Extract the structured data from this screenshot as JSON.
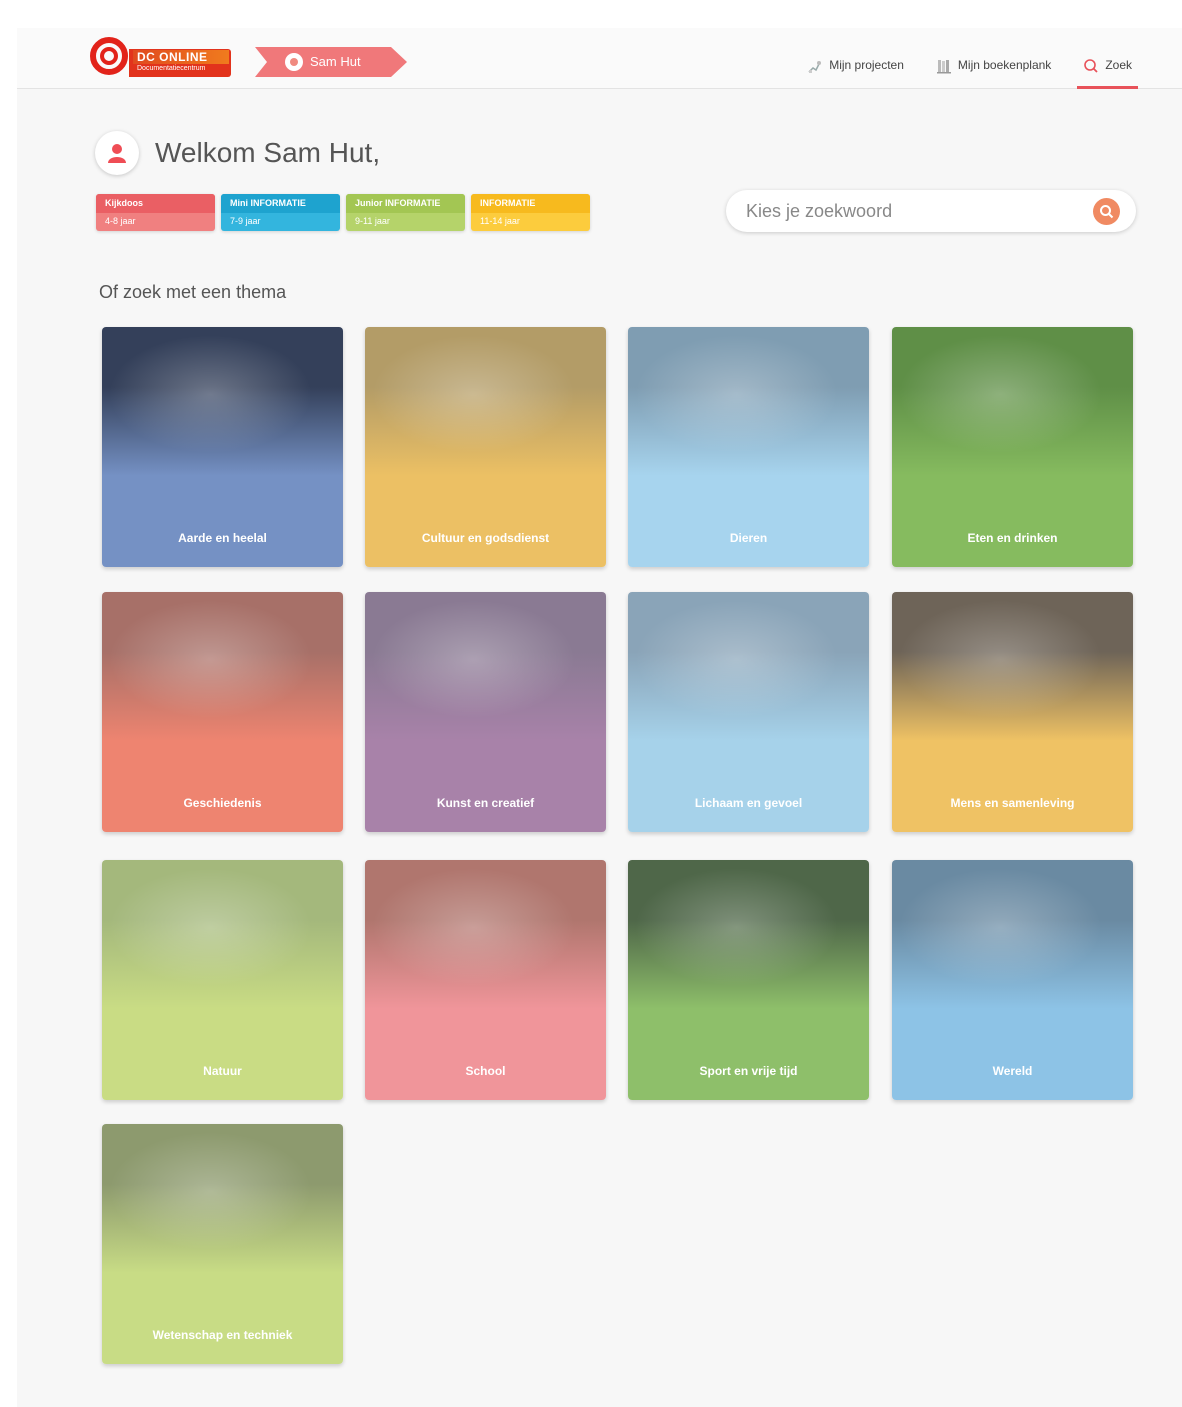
{
  "header": {
    "logo_title": "DC ONLINE",
    "logo_subtitle": "Documentatiecentrum",
    "user_tab": "Sam Hut",
    "nav": [
      {
        "label": "Mijn projecten",
        "icon": "projects-icon"
      },
      {
        "label": "Mijn boekenplank",
        "icon": "bookshelf-icon"
      },
      {
        "label": "Zoek",
        "icon": "search-icon",
        "active": true
      }
    ]
  },
  "welcome": "Welkom Sam Hut,",
  "age_groups": [
    {
      "name": "Kijkdoos",
      "range": "4-8 jaar",
      "color": "#f08080",
      "color_dark": "#ea5f64"
    },
    {
      "name": "Mini INFORMATIE",
      "range": "7-9 jaar",
      "color": "#33b5de",
      "color_dark": "#1ea3cf"
    },
    {
      "name": "Junior INFORMATIE",
      "range": "9-11 jaar",
      "color": "#b5d36a",
      "color_dark": "#a3c653"
    },
    {
      "name": "INFORMATIE",
      "range": "11-14 jaar",
      "color": "#fccc3d",
      "color_dark": "#f7ba1e"
    }
  ],
  "search": {
    "placeholder": "Kies je zoekwoord"
  },
  "theme_heading": "Of zoek met een thema",
  "themes": [
    {
      "label": "Aarde en heelal",
      "color": "#7591c4",
      "dark": "#34405a"
    },
    {
      "label": "Cultuur en godsdienst",
      "color": "#ecc064",
      "dark": "#b39c67"
    },
    {
      "label": "Dieren",
      "color": "#a7d4ee",
      "dark": "#7f9db2"
    },
    {
      "label": "Eten en drinken",
      "color": "#86bb5f",
      "dark": "#5f8f47"
    },
    {
      "label": "Geschiedenis",
      "color": "#ee8470",
      "dark": "#a77068"
    },
    {
      "label": "Kunst en creatief",
      "color": "#a882a9",
      "dark": "#8a7a93"
    },
    {
      "label": "Lichaam en gevoel",
      "color": "#a6d2ea",
      "dark": "#8aa4b8"
    },
    {
      "label": "Mens en samenleving",
      "color": "#efc264",
      "dark": "#6e6458"
    },
    {
      "label": "Natuur",
      "color": "#c9dc84",
      "dark": "#a4b87c"
    },
    {
      "label": "School",
      "color": "#f0959a",
      "dark": "#b0766e"
    },
    {
      "label": "Sport en vrije tijd",
      "color": "#8ebf6a",
      "dark": "#4f6749"
    },
    {
      "label": "Wereld",
      "color": "#8dc3e6",
      "dark": "#6a8aa2"
    },
    {
      "label": "Wetenschap en techniek",
      "color": "#c8dc85",
      "dark": "#8d9a6e"
    }
  ]
}
